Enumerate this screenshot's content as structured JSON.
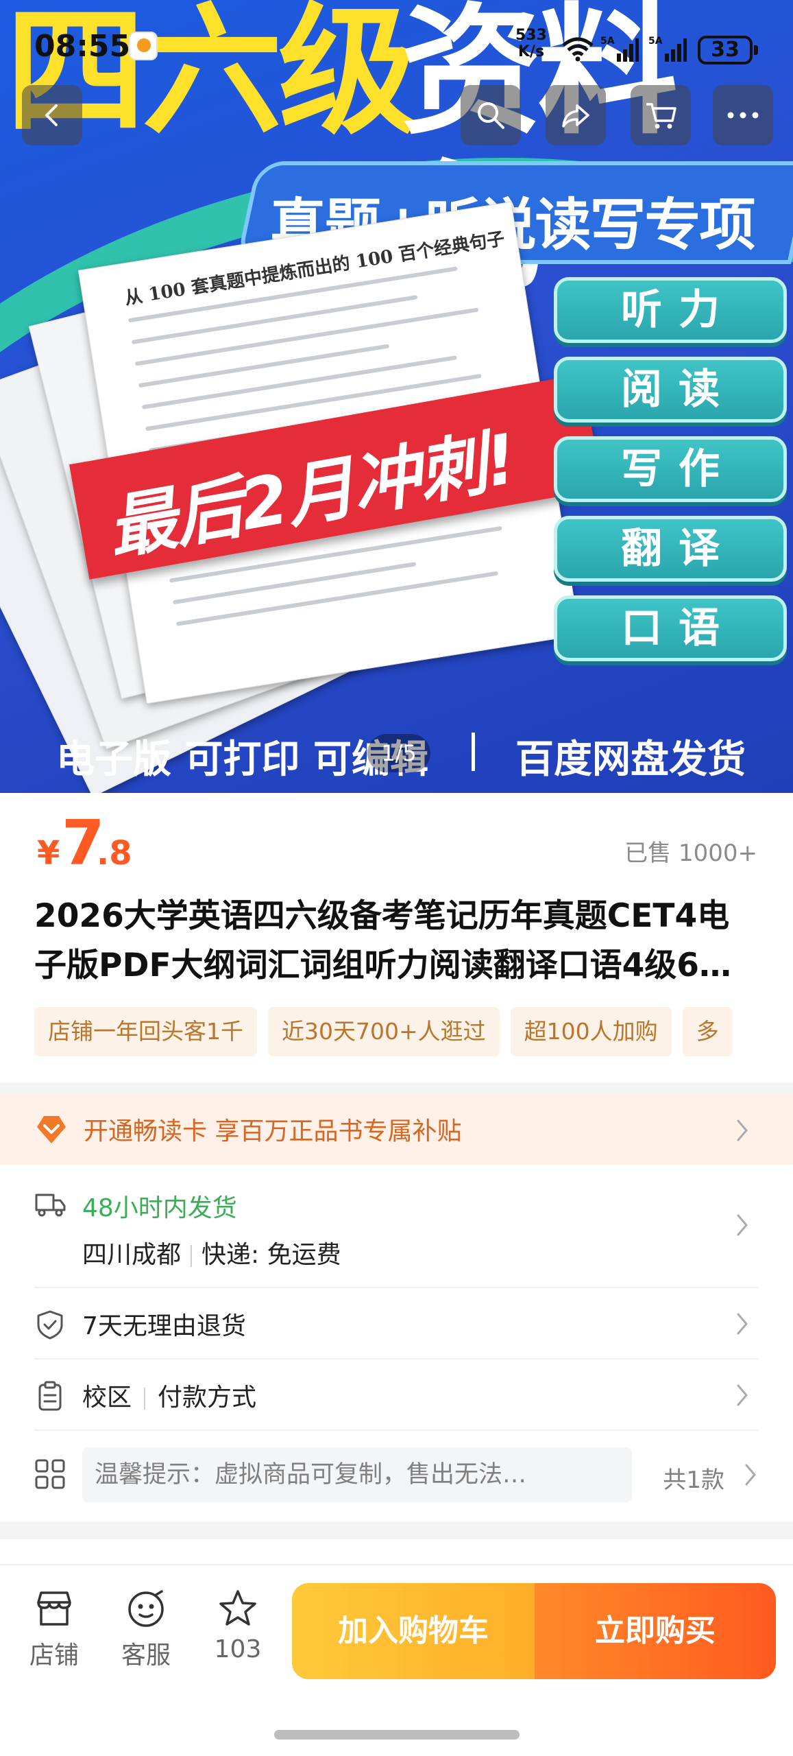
{
  "status_bar": {
    "time": "08:55",
    "net_speed": "533",
    "net_unit": "K/s",
    "signal_badge_1": "5A",
    "signal_badge_2": "5A",
    "battery": "33"
  },
  "hero": {
    "title_yellow": "四六级",
    "title_white": "资料包",
    "subtitle": "真题+听说读写专项",
    "paper_heading": "从 100 套真题中提炼而出的 100 百个经典句子",
    "sprint_label": "最后2月冲刺!",
    "skills": [
      "听力",
      "阅读",
      "写作",
      "翻译",
      "口语"
    ],
    "footer_left": "电子版 可打印 可编辑",
    "footer_right": "百度网盘发货",
    "pager": "1/5"
  },
  "product": {
    "price_symbol": "¥",
    "price_int": "7",
    "price_dec": ".8",
    "sold": "已售 1000+",
    "title_line1": "2026大学英语四六级备考笔记历年真题CET4电",
    "title_line2": "子版PDF大纲词汇词组听力阅读翻译口语4级6…",
    "tags": [
      "店铺一年回头客1千",
      "近30天700+人逛过",
      "超100人加购",
      "多"
    ]
  },
  "promo": {
    "text": "开通畅读卡 享百万正品书专属补贴",
    "accent": "#d76622"
  },
  "services": {
    "ship_time": "48小时内发货",
    "ship_from": "四川成都",
    "ship_method_label": "快递:",
    "ship_fee": "免运费",
    "returns": "7天无理由退货",
    "campus": "校区",
    "payment": "付款方式",
    "tip": "温馨提示：虚拟商品可复制，售出无法…",
    "tip_count": "共1款"
  },
  "bottom_bar": {
    "shop": "店铺",
    "service": "客服",
    "favorites": "103",
    "add_cart": "加入购物车",
    "buy_now": "立即购买",
    "cart_color": "#ffb02e",
    "buy_color": "#ff6a24"
  }
}
